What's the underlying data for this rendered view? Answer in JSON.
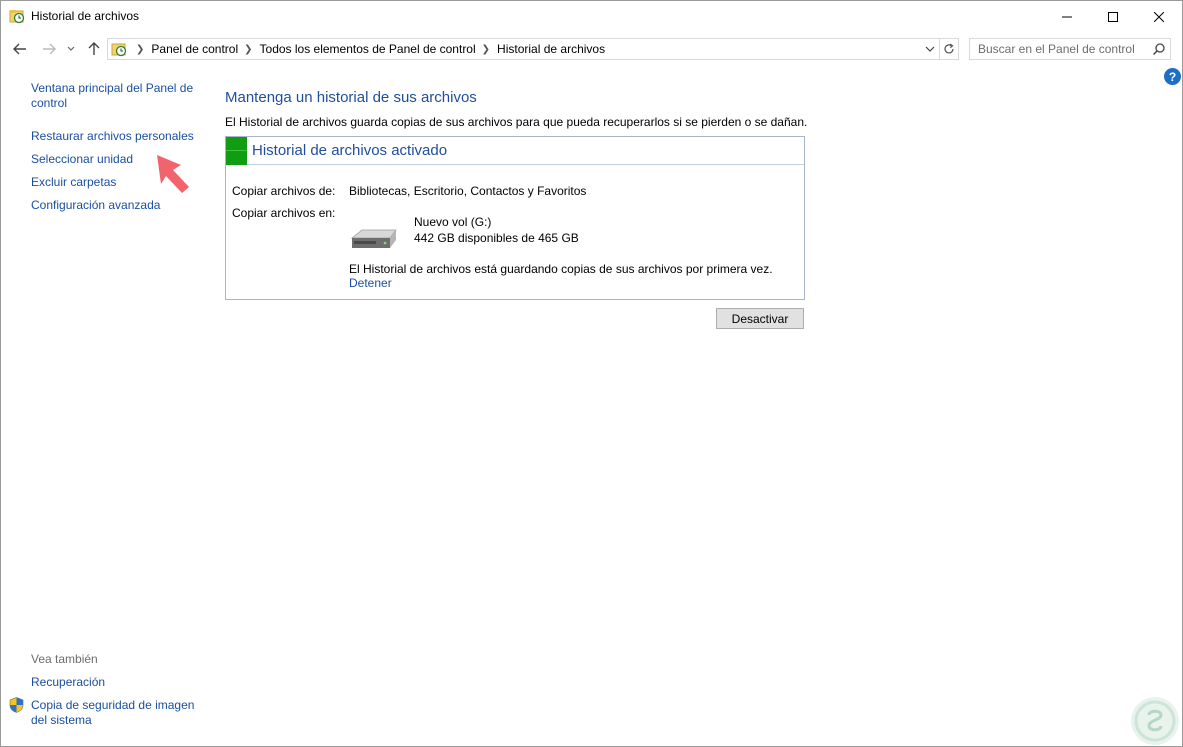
{
  "window": {
    "title": "Historial de archivos"
  },
  "address": {
    "crumbs": [
      "Panel de control",
      "Todos los elementos de Panel de control",
      "Historial de archivos"
    ]
  },
  "search": {
    "placeholder": "Buscar en el Panel de control"
  },
  "left_nav": {
    "items": [
      "Ventana principal del Panel de control",
      "Restaurar archivos personales",
      "Seleccionar unidad",
      "Excluir carpetas",
      "Configuración avanzada"
    ],
    "see_also_label": "Vea también",
    "see_also": [
      "Recuperación",
      "Copia de seguridad de imagen del sistema"
    ]
  },
  "main": {
    "title": "Mantenga un historial de sus archivos",
    "description": "El Historial de archivos guarda copias de sus archivos para que pueda recuperarlos si se pierden o se dañan.",
    "panel": {
      "title": "Historial de archivos activado",
      "status_color": "#119d11",
      "copy_from_label": "Copiar archivos de:",
      "copy_from_value": "Bibliotecas, Escritorio, Contactos y Favoritos",
      "copy_to_label": "Copiar archivos en:",
      "drive_name": "Nuevo vol (G:)",
      "drive_space": "442 GB disponibles de 465 GB",
      "status_message": "El Historial de archivos está guardando copias de sus archivos por primera vez.",
      "stop_link": "Detener"
    },
    "deactivate_button": "Desactivar"
  },
  "colors": {
    "link": "#1a4fa0",
    "heading": "#1f4e9b",
    "arrow": "#f0646e"
  },
  "icons": {
    "back": "back-arrow-icon",
    "forward": "forward-arrow-icon",
    "up": "up-arrow-icon",
    "refresh": "refresh-icon",
    "search": "search-icon",
    "help": "help-icon"
  }
}
